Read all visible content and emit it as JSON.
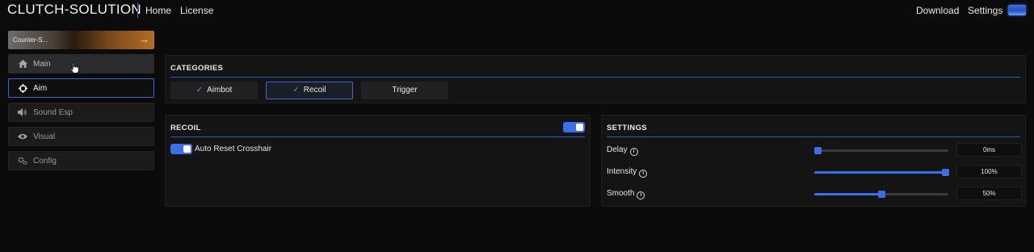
{
  "app": {
    "title": "CLUTCH-SOLUTION",
    "nav": {
      "home": "Home",
      "license": "License"
    },
    "right_nav": {
      "download": "Download",
      "settings": "Settings"
    },
    "accent_color": "#3b6ee8"
  },
  "sidebar": {
    "game": {
      "label": "Counter-S..."
    },
    "items": [
      {
        "label": "Main",
        "icon": "home-icon",
        "state": "hover"
      },
      {
        "label": "Aim",
        "icon": "crosshair-icon",
        "state": "active"
      },
      {
        "label": "Sound Esp",
        "icon": "speaker-icon",
        "state": "normal"
      },
      {
        "label": "Visual",
        "icon": "eye-icon",
        "state": "normal"
      },
      {
        "label": "Config",
        "icon": "cogs-icon",
        "state": "normal"
      }
    ]
  },
  "categories": {
    "title": "CATEGORIES",
    "tabs": [
      {
        "label": "Aimbot",
        "checked": true,
        "selected": false
      },
      {
        "label": "Recoil",
        "checked": true,
        "selected": true
      },
      {
        "label": "Trigger",
        "checked": false,
        "selected": false
      }
    ]
  },
  "recoil": {
    "title": "RECOIL",
    "enabled": true,
    "options": [
      {
        "label": "Auto Reset Crosshair",
        "enabled": true
      }
    ]
  },
  "settings": {
    "title": "SETTINGS",
    "sliders": [
      {
        "label": "Delay",
        "value": 0,
        "display": "0ms"
      },
      {
        "label": "Intensity",
        "value": 100,
        "display": "100%"
      },
      {
        "label": "Smooth",
        "value": 50,
        "display": "50%"
      }
    ]
  }
}
